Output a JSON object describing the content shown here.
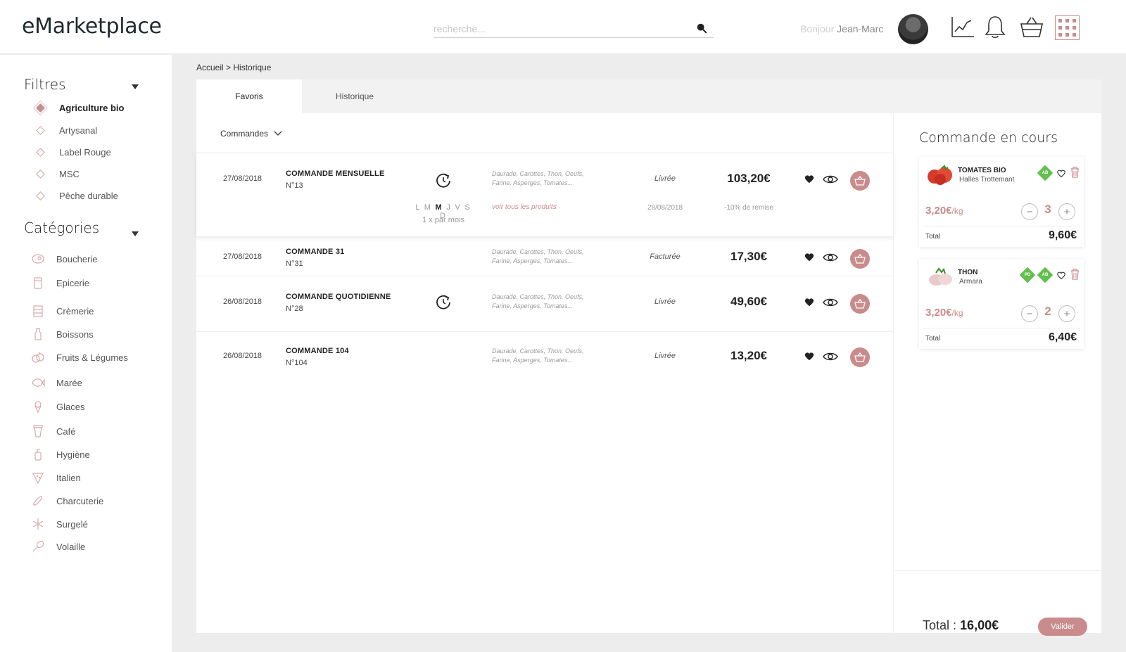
{
  "header": {
    "logo": "eMarketplace",
    "search_placeholder": "recherche...",
    "greeting_prefix": "Bonjour",
    "user_name": "Jean-Marc"
  },
  "sidebar": {
    "filters_title": "Filtres",
    "filters": [
      {
        "label": "Agriculture bio",
        "active": true
      },
      {
        "label": "Artysanal",
        "active": false
      },
      {
        "label": "Label Rouge",
        "active": false
      },
      {
        "label": "MSC",
        "active": false
      },
      {
        "label": "Pêche durable",
        "active": false
      }
    ],
    "categories_title": "Catégories",
    "categories": [
      {
        "label": "Boucherie",
        "icon": "meat-icon"
      },
      {
        "label": "Epicerie",
        "icon": "jar-icon"
      },
      {
        "label": "Crèmerie",
        "icon": "dairy-icon"
      },
      {
        "label": "Boissons",
        "icon": "bottle-icon"
      },
      {
        "label": "Fruits & Légumes",
        "icon": "fruit-icon"
      },
      {
        "label": "Marée",
        "icon": "fish-icon"
      },
      {
        "label": "Glaces",
        "icon": "ice-cream-icon"
      },
      {
        "label": "Café",
        "icon": "coffee-icon"
      },
      {
        "label": "Hygiène",
        "icon": "soap-icon"
      },
      {
        "label": "Italien",
        "icon": "pizza-icon"
      },
      {
        "label": "Charcuterie",
        "icon": "sausage-icon"
      },
      {
        "label": "Surgelé",
        "icon": "snowflake-icon"
      },
      {
        "label": "Volaille",
        "icon": "drumstick-icon"
      }
    ]
  },
  "breadcrumb": "Accueil > Historique",
  "tabs": [
    {
      "label": "Favoris",
      "active": true
    },
    {
      "label": "Historique",
      "active": false
    }
  ],
  "orders_filter": "Commandes",
  "orders": [
    {
      "date": "27/08/2018",
      "title": "COMMANDE MENSUELLE",
      "number": "N°13",
      "recurring": true,
      "products": "Daurade, Carottes, Thon, Oeufs, Farine, Asperges, Tomates...",
      "status": "Livrée",
      "price": "103,20€",
      "days_pre": "L M ",
      "days_active": "M",
      "days_post": " J V S D",
      "frequency": "1 x par mois",
      "see_all": "voir tous les produits",
      "delivery_date": "28/08/2018",
      "discount": "-10% de remise"
    },
    {
      "date": "27/08/2018",
      "title": "COMMANDE 31",
      "number": "N°31",
      "recurring": false,
      "products": "Daurade, Carottes, Thon, Oeufs, Farine, Asperges, Tomates...",
      "status": "Facturée",
      "price": "17,30€"
    },
    {
      "date": "26/08/2018",
      "title": "COMMANDE QUOTIDIENNE",
      "number": "N°28",
      "recurring": true,
      "products": "Daurade, Carottes, Thon, Oeufs, Farine, Asperges, Tomates...",
      "status": "Livrée",
      "price": "49,60€"
    },
    {
      "date": "26/08/2018",
      "title": "COMMANDE 104",
      "number": "N°104",
      "recurring": false,
      "products": "Daurade, Carottes, Thon, Oeufs, Farine, Asperges, Tomates...",
      "status": "Livrée",
      "price": "13,20€"
    }
  ],
  "cart": {
    "title": "Commande en cours",
    "items": [
      {
        "name": "TOMATES BIO",
        "supplier": "Halles Trottemant",
        "badges": [
          "AB"
        ],
        "price": "3,20€",
        "unit": "/kg",
        "qty": "3",
        "total_label": "Total",
        "total": "9,60€"
      },
      {
        "name": "THON",
        "supplier": "Armara",
        "badges": [
          "PD",
          "AB"
        ],
        "price": "3,20€",
        "unit": "/kg",
        "qty": "2",
        "total_label": "Total",
        "total": "6,40€"
      }
    ],
    "total_label": "Total :",
    "total_value": "16,00€",
    "validate": "Valider"
  },
  "colors": {
    "accent": "#c98b8b",
    "badge_green": "#63c04f",
    "background": "#ededee"
  }
}
